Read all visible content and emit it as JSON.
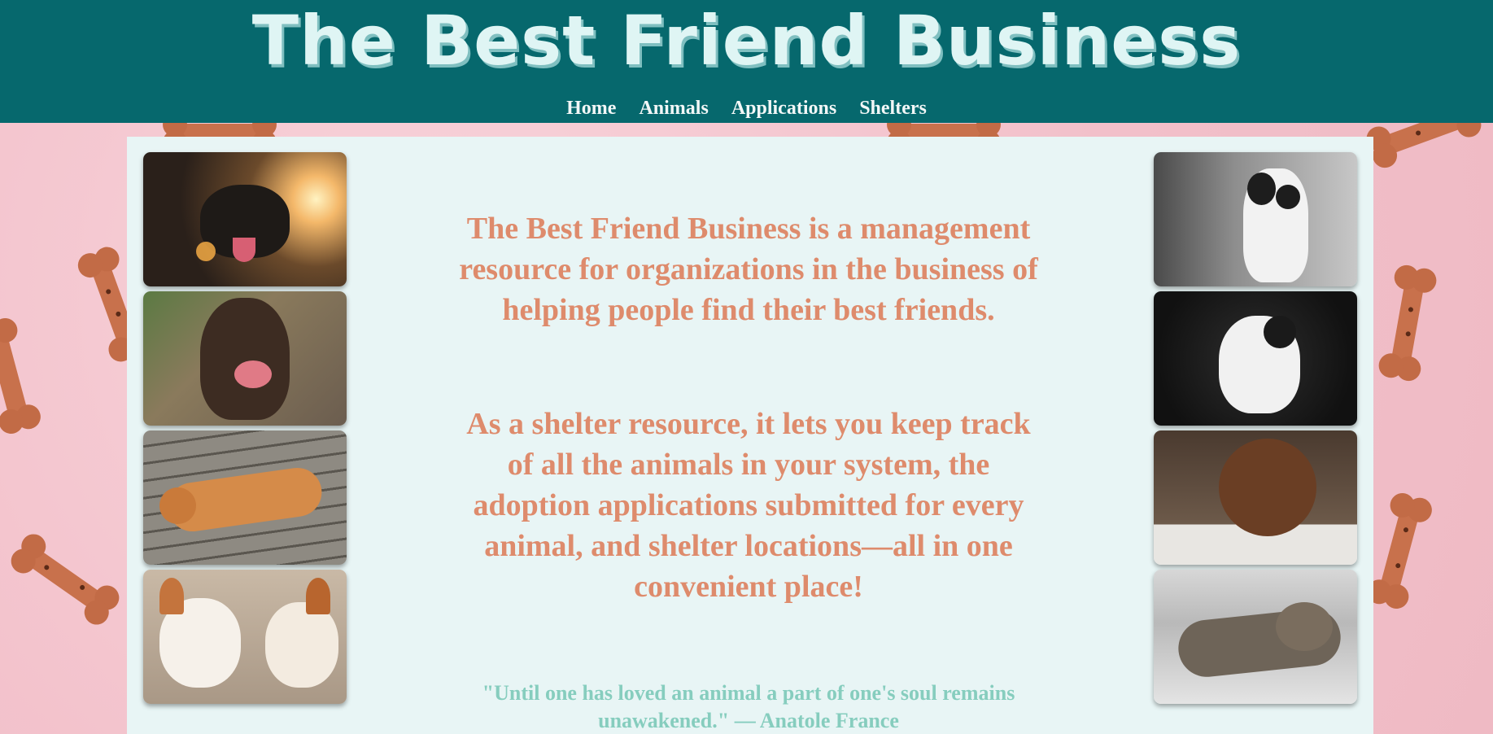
{
  "header": {
    "site_title": "The Best Friend Business",
    "nav": [
      "Home",
      "Animals",
      "Applications",
      "Shelters"
    ]
  },
  "main": {
    "intro_1": "The Best Friend Business is a management resource for organizations in the business of helping people find their best friends.",
    "intro_2": "As a shelter resource, it lets you keep track of all the animals in your system, the adoption applications submitted for every animal, and shelter locations—all in one convenient place!",
    "quote": "\"Until one has loved an animal a part of one's soul remains unawakened.\" — Anatole France"
  },
  "photos": {
    "left": [
      "dog-in-car-photo",
      "chocolate-lab-licking-photo",
      "orange-cat-on-deck-photo",
      "two-corgis-photo"
    ],
    "right": [
      "spotted-puppy-on-street-photo",
      "white-kitten-photo",
      "brown-puppy-photo",
      "tabby-cat-lying-photo"
    ]
  },
  "colors": {
    "header_bg": "#06686d",
    "title_text": "#dff5f4",
    "panel_bg": "#e8f5f5",
    "body_text": "#de8b6c",
    "quote_text": "#86cdbe",
    "page_bg": "#f4c6cf"
  }
}
